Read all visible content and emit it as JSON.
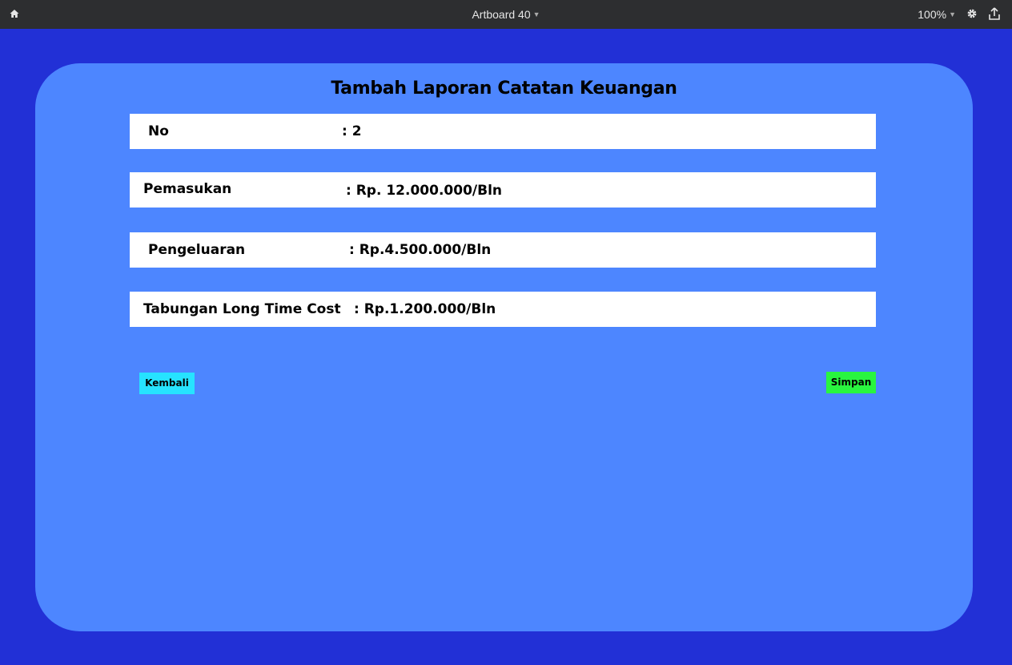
{
  "topbar": {
    "title": "Artboard 40",
    "zoom": "100%",
    "icons": [
      "home-icon",
      "chevron-down-icon",
      "gear-icon",
      "share-icon"
    ]
  },
  "form": {
    "title": "Tambah Laporan Catatan Keuangan",
    "rows": [
      {
        "label": "No",
        "value": ": 2"
      },
      {
        "label": "Pemasukan",
        "value": ": Rp. 12.000.000/Bln"
      },
      {
        "label": "Pengeluaran",
        "value": ": Rp.4.500.000/Bln"
      },
      {
        "label": "Tabungan Long Time Cost",
        "value": ": Rp.1.200.000/Bln"
      }
    ],
    "back_label": "Kembali",
    "save_label": "Simpan"
  },
  "colors": {
    "background": "#2230d6",
    "card": "#4d86ff",
    "back_button": "#26e3ff",
    "save_button": "#29f53f",
    "topbar": "#2d2e30"
  }
}
